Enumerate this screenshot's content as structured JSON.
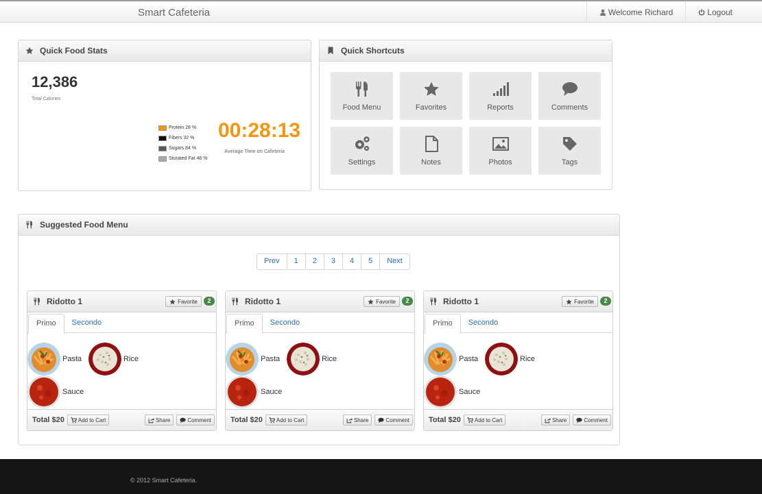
{
  "navbar": {
    "brand": "Smart Cafeteria",
    "welcome": "Welcome Richard",
    "logout": "Logout"
  },
  "stats": {
    "title": "Quick Food Stats",
    "total_calories": "12,386",
    "total_calories_label": "Total Calories",
    "legend": [
      {
        "label": "Protein 28 %",
        "color": "#f7960e"
      },
      {
        "label": "Fibers 32 %",
        "color": "#111111"
      },
      {
        "label": "Sugars 84 %",
        "color": "#5a5a5a"
      },
      {
        "label": "Sturated Fat 46 %",
        "color": "#a8a8a8"
      }
    ],
    "avg_time": "00:28:13",
    "avg_time_label": "Average Time on Cafeteria",
    "accent_color": "#f7960e"
  },
  "shortcuts": {
    "title": "Quick Shortcuts",
    "items": [
      {
        "label": "Food Menu",
        "icon": "utensils-icon"
      },
      {
        "label": "Favorites",
        "icon": "star-icon"
      },
      {
        "label": "Reports",
        "icon": "signal-bars-icon"
      },
      {
        "label": "Comments",
        "icon": "comment-icon"
      },
      {
        "label": "Settings",
        "icon": "gears-icon"
      },
      {
        "label": "Notes",
        "icon": "document-icon"
      },
      {
        "label": "Photos",
        "icon": "picture-icon"
      },
      {
        "label": "Tags",
        "icon": "tag-icon"
      }
    ]
  },
  "menu": {
    "title": "Suggested Food Menu",
    "pagination": [
      "Prev",
      "1",
      "2",
      "3",
      "4",
      "5",
      "Next"
    ],
    "cards": [
      {
        "title": "Ridotto 1",
        "favorite_label": "Favorite",
        "badge": "2",
        "tabs": [
          "Primo",
          "Secondo"
        ],
        "foods": [
          "Pasta",
          "Rice",
          "Sauce"
        ],
        "total": "Total $20",
        "add_to_cart": "Add to Cart",
        "share": "Share",
        "comment": "Comment"
      },
      {
        "title": "Ridotto 1",
        "favorite_label": "Favorite",
        "badge": "2",
        "tabs": [
          "Primo",
          "Secondo"
        ],
        "foods": [
          "Pasta",
          "Rice",
          "Sauce"
        ],
        "total": "Total $20",
        "add_to_cart": "Add to Cart",
        "share": "Share",
        "comment": "Comment"
      },
      {
        "title": "Ridotto 1",
        "favorite_label": "Favorite",
        "badge": "2",
        "tabs": [
          "Primo",
          "Secondo"
        ],
        "foods": [
          "Pasta",
          "Rice",
          "Sauce"
        ],
        "total": "Total $20",
        "add_to_cart": "Add to Cart",
        "share": "Share",
        "comment": "Comment"
      }
    ]
  },
  "footer": {
    "copyright": "© 2012 Smart Cafeteria."
  }
}
